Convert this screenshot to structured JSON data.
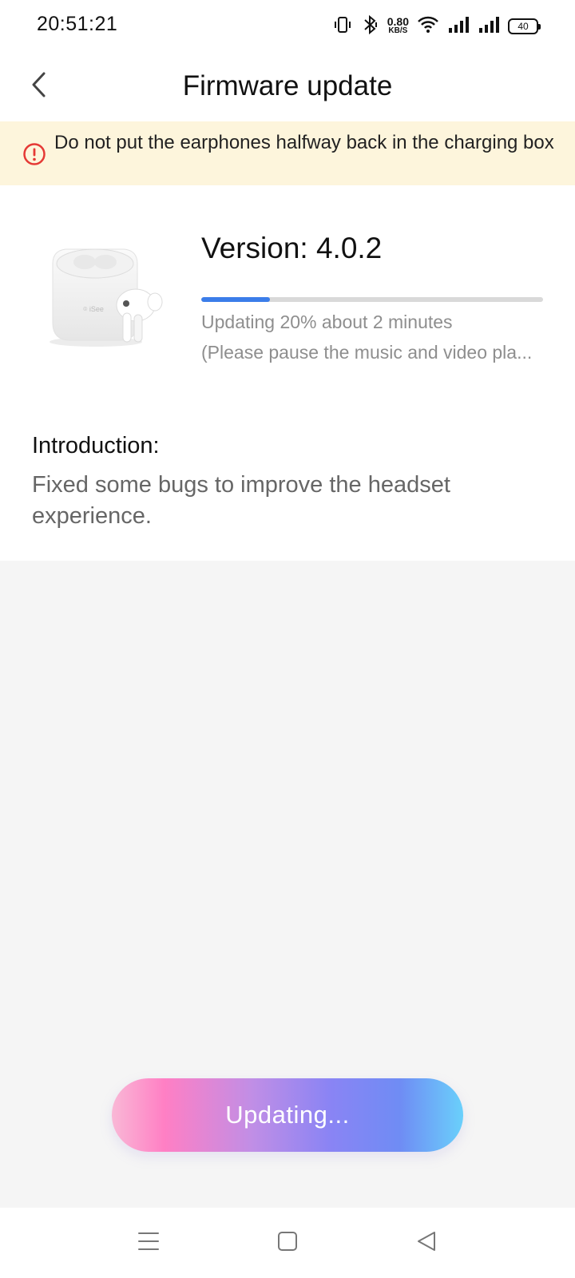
{
  "status_bar": {
    "time": "20:51:21",
    "net_speed_value": "0.80",
    "net_speed_unit": "KB/S",
    "battery": "40",
    "icons": [
      "vibrate-icon",
      "bluetooth-icon",
      "wifi-icon",
      "signal-icon",
      "signal-icon-2",
      "battery-icon"
    ]
  },
  "header": {
    "title": "Firmware update",
    "back_icon": "chevron-left-icon"
  },
  "warning": {
    "icon": "alert-circle-icon",
    "text": "Do not put the earphones halfway back in the charging box",
    "color": "#e53935"
  },
  "firmware": {
    "version_label": "Version: 4.0.2",
    "progress_percent": 20,
    "progress_text": "Updating 20% about 2 minutes",
    "progress_note": "(Please pause the music and video pla...",
    "accent_color": "#3b7de9"
  },
  "introduction": {
    "title": "Introduction:",
    "body": "Fixed some bugs to improve the headset experience."
  },
  "actions": {
    "update_button_label": "Updating..."
  },
  "nav_bar": {
    "icons": [
      "menu-icon",
      "home-square-icon",
      "back-triangle-icon"
    ]
  }
}
